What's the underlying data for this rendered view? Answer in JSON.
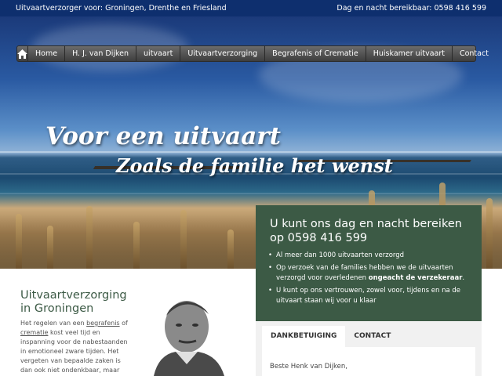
{
  "topbar": {
    "left_text": "Uitvaartverzorger voor: Groningen, Drenthe en Friesland",
    "right_text": "Dag en nacht bereikbaar: 0598 416 599"
  },
  "nav": {
    "home_icon": "home-icon",
    "items": [
      "Home",
      "H. J. van Dijken",
      "uitvaart",
      "Uitvaartverzorging",
      "Begrafenis of Crematie",
      "Huiskamer uitvaart",
      "Contact"
    ]
  },
  "hero": {
    "slogan_line1": "Voor een uitvaart",
    "slogan_line2": "Zoals de familie het wenst"
  },
  "contact_box": {
    "heading": "U kunt ons dag en nacht bereiken op 0598 416 599",
    "bullets": [
      {
        "text": "Al meer dan 1000 uitvaarten verzorgd"
      },
      {
        "text_before": "Op verzoek van de families hebben we de uitvaarten verzorgd voor overledenen ",
        "bold": "ongeacht de verzekeraar",
        "text_after": "."
      },
      {
        "text": "U kunt op ons vertrouwen, zowel voor, tijdens en na de uitvaart staan wij voor u klaar"
      }
    ],
    "background_color": "#3c5a45"
  },
  "content": {
    "title": "Uitvaartverzorging in Groningen",
    "para_1": "Het regelen van een ",
    "link_begrafenis": "begrafenis",
    "para_2": " of ",
    "link_crematie": "crematie",
    "para_3": " kost veel tijd en inspanning voor de nabestaanden in emotioneel zware tijden. Het vergeten van bepaalde zaken is dan ook niet ondenkbaar, maar wel ongewenst bij"
  },
  "tabs": {
    "items": [
      "DANKBETUIGING",
      "CONTACT"
    ],
    "greeting": "Beste Henk van Dijken,"
  },
  "colors": {
    "topbar": "#0e2f6e",
    "accent_green": "#3c5a45",
    "nav_dark": "#3e3e3e"
  }
}
